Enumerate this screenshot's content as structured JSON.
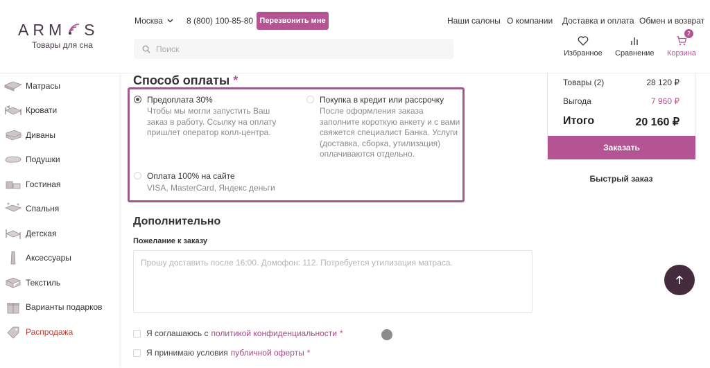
{
  "brand": {
    "logo_text_left": "ARM",
    "logo_text_right": "S",
    "tagline": "Товары для сна"
  },
  "header": {
    "city": "Москва",
    "phone": "8 (800) 100-85-80",
    "callback_label": "Перезвонить мне",
    "nav": [
      "Наши салоны",
      "О компании",
      "Доставка и оплата",
      "Обмен и возврат"
    ],
    "search_placeholder": "Поиск",
    "icons": [
      {
        "label": "Избранное",
        "icon": "heart-icon"
      },
      {
        "label": "Сравнение",
        "icon": "compare-icon"
      },
      {
        "label": "Корзина",
        "icon": "cart-icon",
        "badge": "2"
      }
    ]
  },
  "sidebar": {
    "items": [
      {
        "label": "Матрасы",
        "highlight": false
      },
      {
        "label": "Кровати",
        "highlight": false
      },
      {
        "label": "Диваны",
        "highlight": false
      },
      {
        "label": "Подушки",
        "highlight": false
      },
      {
        "label": "Гостиная",
        "highlight": false
      },
      {
        "label": "Спальня",
        "highlight": false
      },
      {
        "label": "Детская",
        "highlight": false
      },
      {
        "label": "Аксессуары",
        "highlight": false
      },
      {
        "label": "Текстиль",
        "highlight": false
      },
      {
        "label": "Варианты подарков",
        "highlight": false
      },
      {
        "label": "Распродажа",
        "highlight": true
      }
    ]
  },
  "payment": {
    "title": "Способ оплаты",
    "required_mark": "*",
    "options": [
      {
        "title": "Предоплата 30%",
        "desc": "Чтобы мы могли запустить Ваш заказ в работу. Ссылку на оплату пришлет оператор колл-центра.",
        "selected": true
      },
      {
        "title": "Покупка в кредит или рассрочку",
        "desc": "После оформления заказа заполните короткую анкету и с вами свяжется специалист Банка. Услуги (доставка, сборка, утилизация) оплачиваются отдельно.",
        "selected": false
      },
      {
        "title": "Оплата 100% на сайте",
        "desc": "VISA, MasterCard, Яндекс деньги",
        "selected": false
      }
    ]
  },
  "additional": {
    "title": "Дополнительно",
    "wish_label": "Пожелание к заказу",
    "wish_placeholder": "Прошу доставить после 16:00. Домофон: 112. Потребуется утилизация матраса."
  },
  "consents": [
    {
      "text": "Я соглашаюсь с",
      "link": "политикой конфиденциальности",
      "mark": "*"
    },
    {
      "text": "Я принимаю условия",
      "link": "публичной оферты",
      "mark": "*"
    }
  ],
  "summary": {
    "items_label": "Товары (2)",
    "items_value": "28 120 ₽",
    "benefit_label": "Выгода",
    "benefit_value": "7 960 ₽",
    "total_label": "Итого",
    "total_value": "20 160 ₽",
    "order_button": "Заказать",
    "quick_order": "Быстрый заказ"
  },
  "colors": {
    "accent": "#b55493",
    "dark": "#452c3c",
    "sale": "#c0392b"
  }
}
